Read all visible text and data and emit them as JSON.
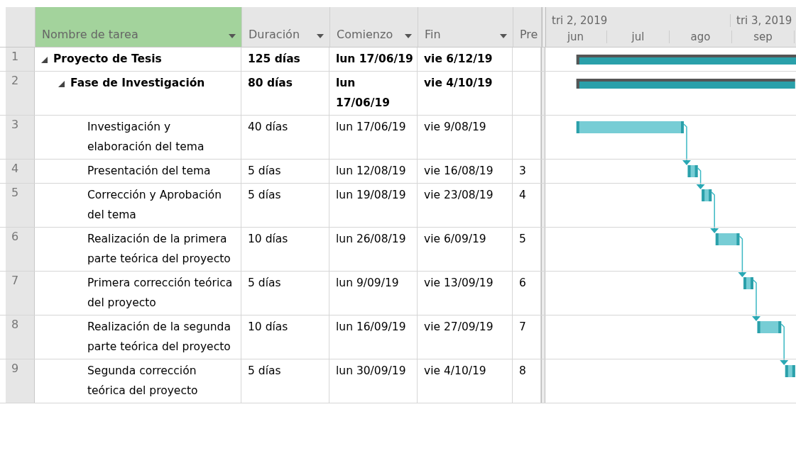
{
  "table": {
    "columns": [
      {
        "label": "Nombre de tarea",
        "selected": true,
        "dropdown": true
      },
      {
        "label": "Duración",
        "selected": false,
        "dropdown": true
      },
      {
        "label": "Comienzo",
        "selected": false,
        "dropdown": true
      },
      {
        "label": "Fin",
        "selected": false,
        "dropdown": true
      },
      {
        "label": "Pre",
        "selected": false,
        "dropdown": false
      }
    ],
    "tasks": [
      {
        "row_number": "1",
        "name": "Proyecto de Tesis",
        "duration": "125 días",
        "start": "lun 17/06/19",
        "finish": "vie 6/12/19",
        "expanded": true,
        "children": [
          {
            "row_number": "2",
            "name": "Fase de Investigación",
            "duration": "80 días",
            "start": "lun 17/06/19",
            "finish": "vie 4/10/19",
            "expanded": true,
            "children": [
              {
                "row_number": "3",
                "name": "Investigación y elaboración del tema",
                "duration": "40 días",
                "start": "lun 17/06/19",
                "finish": "vie 9/08/19"
              },
              {
                "row_number": "4",
                "name": "Presentación del tema",
                "duration": "5 días",
                "start": "lun 12/08/19",
                "finish": "vie 16/08/19",
                "predecessors": "3"
              },
              {
                "row_number": "5",
                "name": "Corrección y Aprobación del tema",
                "duration": "5 días",
                "start": "lun 19/08/19",
                "finish": "vie 23/08/19",
                "predecessors": "4"
              },
              {
                "row_number": "6",
                "name": "Realización de la primera parte teórica del proyecto",
                "duration": "10 días",
                "start": "lun 26/08/19",
                "finish": "vie 6/09/19",
                "predecessors": "5"
              },
              {
                "row_number": "7",
                "name": "Primera corrección teórica del proyecto",
                "duration": "5 días",
                "start": "lun 9/09/19",
                "finish": "vie 13/09/19",
                "predecessors": "6"
              },
              {
                "row_number": "8",
                "name": "Realización de la segunda parte teórica del proyecto",
                "duration": "10 días",
                "start": "lun 16/09/19",
                "finish": "vie 27/09/19",
                "predecessors": "7"
              },
              {
                "row_number": "9",
                "name": "Segunda corrección teórica del proyecto",
                "duration": "5 días",
                "start": "lun 30/09/19",
                "finish": "vie 4/10/19",
                "predecessors": "8"
              }
            ]
          }
        ]
      }
    ]
  },
  "timescale": {
    "quarters": [
      "tri 2, 2019",
      "tri 3, 2019"
    ],
    "months": [
      "jun",
      "jul",
      "ago",
      "sep"
    ]
  }
}
